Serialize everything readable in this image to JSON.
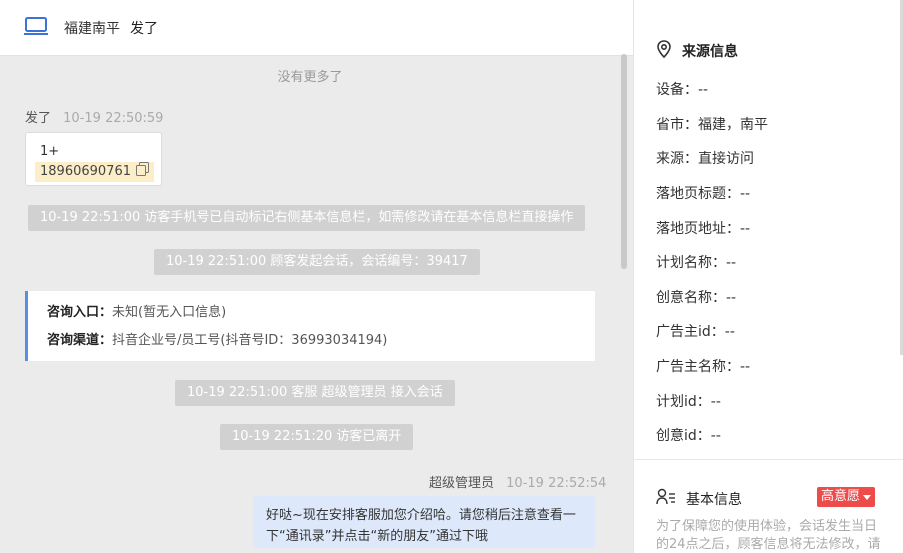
{
  "header": {
    "location": "福建南平",
    "name": "发了"
  },
  "chat": {
    "no_more": "没有更多了",
    "msg1": {
      "sender": "发了",
      "time": "10-19 22:50:59",
      "line1": "1+",
      "phone": "18960690761"
    },
    "sys1": "10-19 22:51:00 访客手机号已自动标记右侧基本信息栏，如需修改请在基本信息栏直接操作",
    "sys2": "10-19 22:51:00 顾客发起会话，会话编号：39417",
    "entry": {
      "k1": "咨询入口：",
      "v1": "未知(暂无入口信息)",
      "k2": "咨询渠道：",
      "v2": "抖音企业号/员工号(抖音号ID：36993034194)"
    },
    "sys3": "10-19 22:51:00 客服 超级管理员 接入会话",
    "sys4": "10-19 22:51:20 访客已离开",
    "msg2": {
      "sender": "超级管理员",
      "time": "10-19 22:52:54",
      "text": "好哒~现在安排客服加您介绍哈。请您稍后注意查看一下“通讯录”并点击“新的朋友”通过下哦"
    }
  },
  "panel": {
    "source_title": "来源信息",
    "rows": [
      "设备：--",
      "省市：福建，南平",
      "来源：直接访问",
      "落地页标题：--",
      "落地页地址：--",
      "计划名称：--",
      "创意名称：--",
      "广告主id：--",
      "广告主名称：--",
      "计划id：--",
      "创意id：--"
    ],
    "basic_title": "基本信息",
    "intent": "高意愿",
    "notice": "为了保障您的使用体验，会话发生当日的24点之后，顾客信息将无法修改，请"
  },
  "colors": {
    "accent": "#5a8ee0",
    "badge": "#ee4b4b",
    "out_bubble": "#dde8fa"
  }
}
